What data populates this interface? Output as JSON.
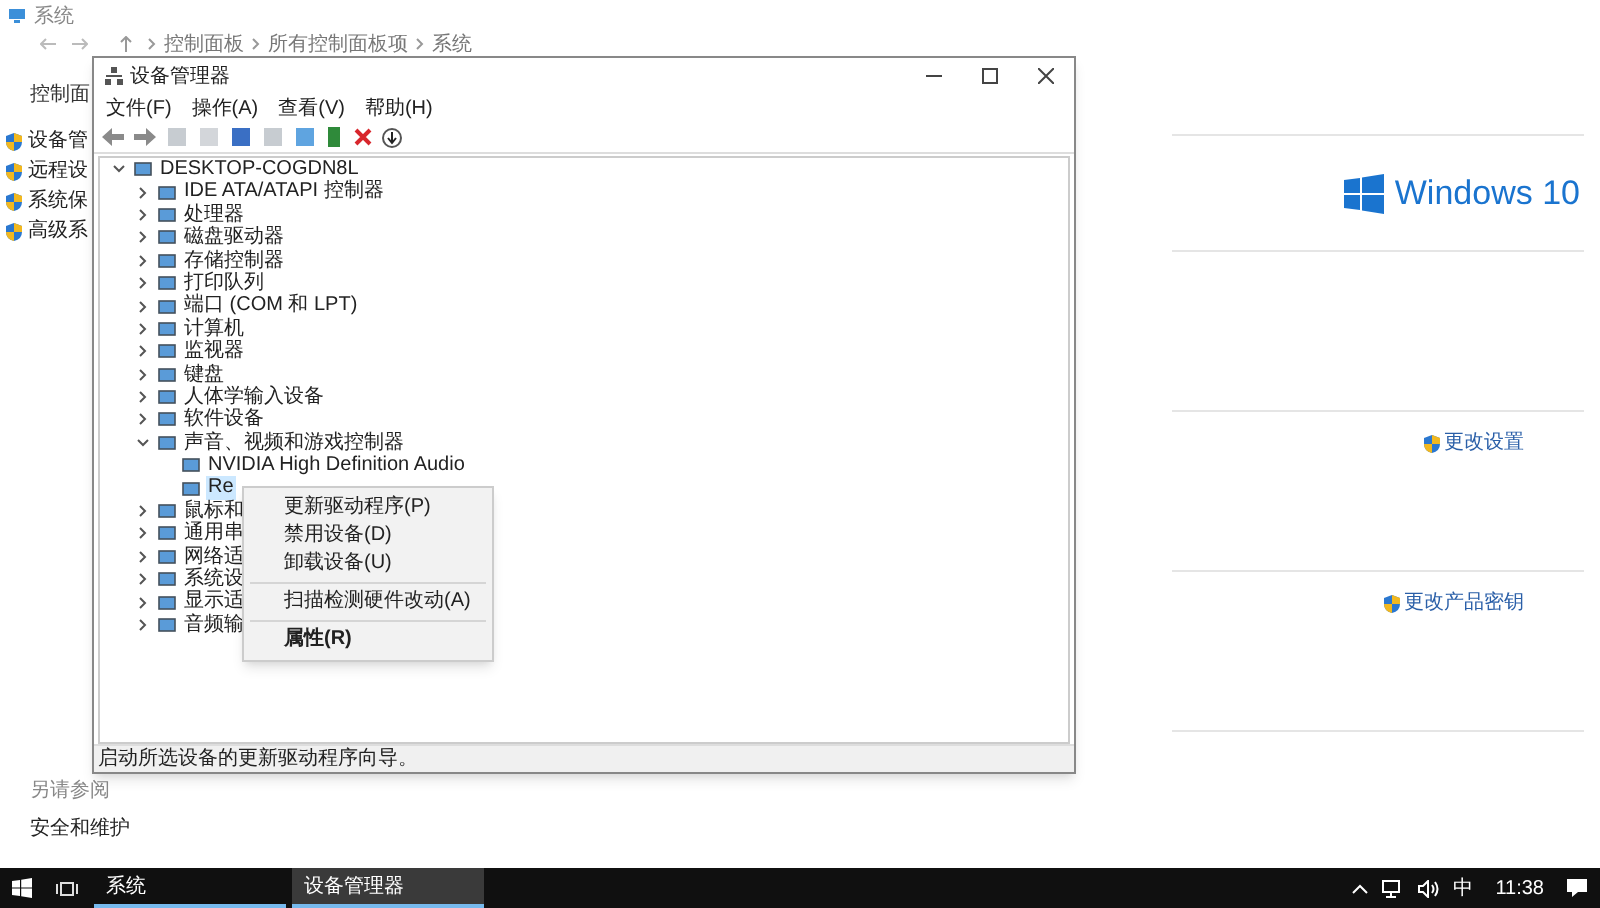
{
  "background_window": {
    "title": "系统",
    "breadcrumb": [
      "控制面板",
      "所有控制面板项",
      "系统"
    ],
    "sidebar_heading": "控制面",
    "sidebar": [
      "设备管",
      "远程设",
      "系统保",
      "高级系"
    ],
    "logo_text": "Windows 10",
    "links": [
      "更改设置",
      "更改产品密钥"
    ],
    "see_also": {
      "heading": "另请参阅",
      "links": [
        "安全和维护"
      ]
    }
  },
  "device_manager": {
    "title": "设备管理器",
    "menu": [
      "文件(F)",
      "操作(A)",
      "查看(V)",
      "帮助(H)"
    ],
    "tree": {
      "label": "DESKTOP-COGDN8L",
      "expanded": true,
      "children": [
        {
          "label": "IDE ATA/ATAPI 控制器",
          "expanded": false
        },
        {
          "label": "处理器",
          "expanded": false
        },
        {
          "label": "磁盘驱动器",
          "expanded": false
        },
        {
          "label": "存储控制器",
          "expanded": false
        },
        {
          "label": "打印队列",
          "expanded": false
        },
        {
          "label": "端口 (COM 和 LPT)",
          "expanded": false
        },
        {
          "label": "计算机",
          "expanded": false
        },
        {
          "label": "监视器",
          "expanded": false
        },
        {
          "label": "键盘",
          "expanded": false
        },
        {
          "label": "人体学输入设备",
          "expanded": false
        },
        {
          "label": "软件设备",
          "expanded": false
        },
        {
          "label": "声音、视频和游戏控制器",
          "expanded": true,
          "children": [
            {
              "label": "NVIDIA High Definition Audio",
              "selected": false
            },
            {
              "label": "Re",
              "selected": true
            }
          ]
        },
        {
          "label": "鼠标和",
          "expanded": false
        },
        {
          "label": "通用串",
          "expanded": false
        },
        {
          "label": "网络适",
          "expanded": false
        },
        {
          "label": "系统设",
          "expanded": false
        },
        {
          "label": "显示适",
          "expanded": false
        },
        {
          "label": "音频输",
          "expanded": false
        }
      ]
    },
    "status": "启动所选设备的更新驱动程序向导。"
  },
  "context_menu": [
    {
      "kind": "item",
      "label": "更新驱动程序(P)",
      "bold": false
    },
    {
      "kind": "item",
      "label": "禁用设备(D)",
      "bold": false
    },
    {
      "kind": "item",
      "label": "卸载设备(U)",
      "bold": false
    },
    {
      "kind": "separator"
    },
    {
      "kind": "item",
      "label": "扫描检测硬件改动(A)",
      "bold": false
    },
    {
      "kind": "separator"
    },
    {
      "kind": "item",
      "label": "属性(R)",
      "bold": true
    }
  ],
  "taskbar": {
    "apps": [
      {
        "label": "系统",
        "selected": false
      },
      {
        "label": "设备管理器",
        "selected": true
      }
    ],
    "ime": "中",
    "time": "11:38"
  }
}
